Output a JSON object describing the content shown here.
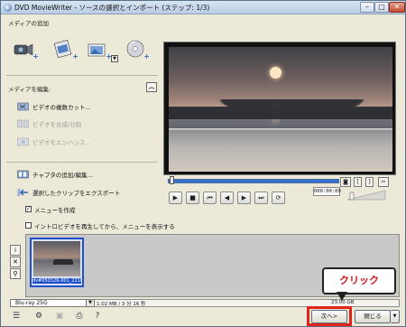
{
  "window": {
    "title": "DVD MovieWriter - ソースの選択とインポート (ステップ: 1/3)",
    "min_glyph": "–",
    "max_glyph": "□",
    "close_glyph": "✕"
  },
  "left_panel": {
    "add_media_label": "メディアの追加",
    "edit_media_label": "メディアを編集:",
    "collapse_glyph": "︽",
    "edit_items": [
      {
        "label": "ビデオの複数カット...",
        "icon": "scissors-film-icon",
        "enabled": true
      },
      {
        "label": "ビデオを合成/分割",
        "icon": "merge-split-icon",
        "enabled": false
      },
      {
        "label": "ビデオをエンハンス...",
        "icon": "enhance-icon",
        "enabled": false
      }
    ],
    "chapter_item": "チャプタの追加/編集...",
    "export_item": "選択したクリップをエクスポート",
    "create_menu_label": "メニューを作成",
    "create_menu_checked": true,
    "create_menu_check_glyph": "✓",
    "intro_label": "イントロビデオを再生してから、メニューを表示する",
    "intro_checked": false
  },
  "player": {
    "timecode": "000:00:00",
    "controls": [
      "▶",
      "■",
      "⏮",
      "◀",
      "▶",
      "⏭",
      "⟳"
    ]
  },
  "timeline": {
    "clip_label": "dv#050126-001_22160..."
  },
  "storage": {
    "disc_type": "Blu-ray 25G",
    "disc_arrow_glyph": "▼",
    "used_text": "1.02 MB / 3 分 16 秒",
    "total_text": "23.00 GB",
    "used_fraction": 0.0
  },
  "footer": {
    "next_button": "次へ>",
    "close_button": "閉じる",
    "close_drop_glyph": "▼"
  },
  "annotation": {
    "callout_text": "クリック",
    "highlight_color": "#e2231a"
  }
}
